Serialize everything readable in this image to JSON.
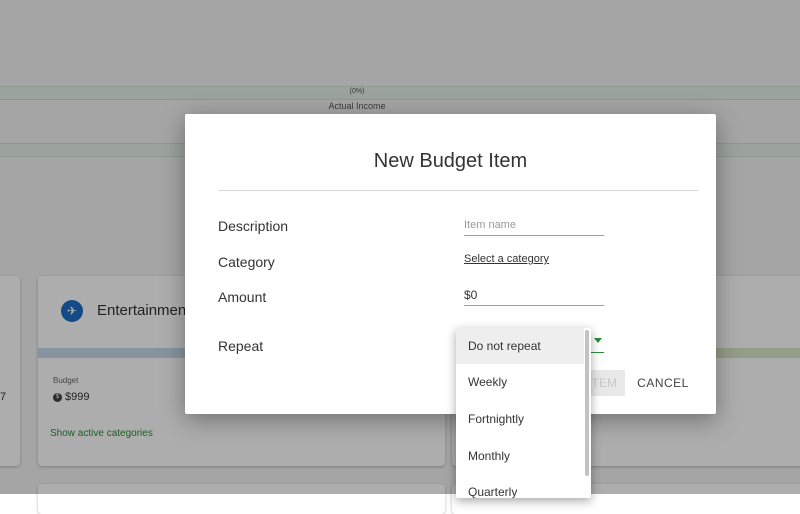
{
  "background": {
    "percent_label": "(0%)",
    "actual_income_label": "Actual Income",
    "left_card_value": "7",
    "entertainment_card": {
      "title": "Entertainment",
      "budget_label": "Budget",
      "budget_value": "$999",
      "show_link": "Show active categories"
    }
  },
  "dialog": {
    "title": "New Budget Item",
    "description_label": "Description",
    "description_placeholder": "Item name",
    "category_label": "Category",
    "category_link": "Select a category",
    "amount_label": "Amount",
    "amount_value": "$0",
    "repeat_label": "Repeat",
    "add_button_label": "ITEM",
    "cancel_button_label": "CANCEL"
  },
  "dropdown": {
    "options": [
      "Do not repeat",
      "Weekly",
      "Fortnightly",
      "Monthly",
      "Quarterly"
    ],
    "selected_index": 0
  },
  "colors": {
    "accent_green": "#2e8b3a",
    "entertainment_icon": "#1e6fc8"
  },
  "icons": {
    "entertainment_icon": "airplane-icon",
    "budget_icon": "coin-icon",
    "repeat_dropdown": "caret-down-icon"
  }
}
